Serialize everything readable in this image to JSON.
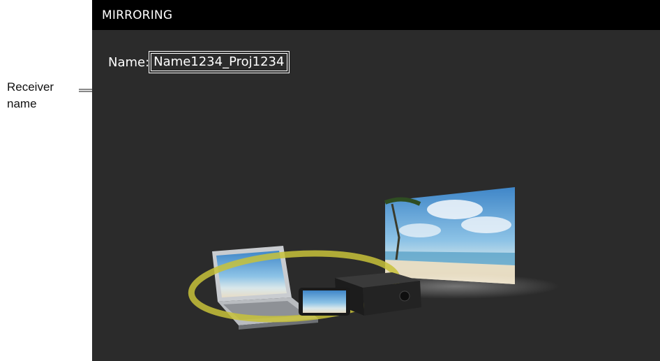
{
  "annotation": {
    "line1": "Receiver",
    "line2": "name"
  },
  "screen": {
    "title": "MIRRORING",
    "name_label": "Name:",
    "name_value": "Name1234_Proj1234"
  },
  "colors": {
    "screen_bg": "#2b2b2b",
    "titlebar_bg": "#000000",
    "text": "#ffffff",
    "ring": "#c8c23a"
  },
  "illustration": {
    "items": [
      "laptop",
      "smartphone",
      "projector",
      "projected-screen",
      "wireless-ring"
    ]
  }
}
